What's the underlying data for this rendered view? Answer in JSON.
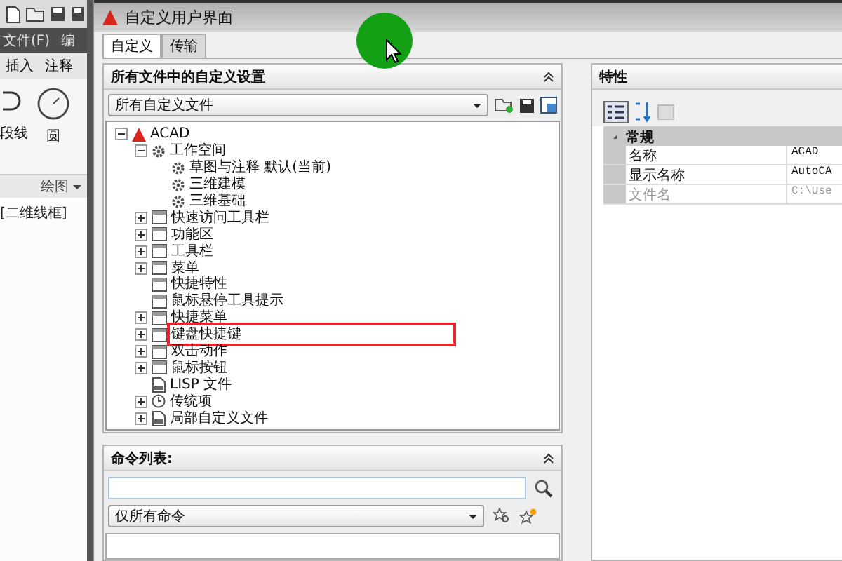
{
  "app": {
    "menu": [
      {
        "label": "文件(F)"
      },
      {
        "label": "编"
      }
    ],
    "ribbon_tabs": [
      {
        "label": "插入"
      },
      {
        "label": "注释"
      }
    ],
    "tools": [
      {
        "label": "段线",
        "kind": "arc"
      },
      {
        "label": "圆",
        "kind": "circle"
      }
    ],
    "panel_label": "绘图",
    "viewport_label": "[二维线框]"
  },
  "dialog": {
    "title": "自定义用户界面",
    "tabs": [
      {
        "label": "自定义",
        "selected": true
      },
      {
        "label": "传输",
        "selected": false
      }
    ]
  },
  "customizations": {
    "title": "所有文件中的自定义设置",
    "filter": "所有自定义文件",
    "tree": [
      {
        "label": "ACAD",
        "kind": "logo",
        "expanded": true,
        "children": [
          {
            "label": "工作空间",
            "kind": "gear",
            "expanded": true,
            "children": [
              {
                "label": "草图与注释 默认(当前)",
                "kind": "gear"
              },
              {
                "label": "三维建模",
                "kind": "gear"
              },
              {
                "label": "三维基础",
                "kind": "gear"
              }
            ]
          },
          {
            "label": "快速访问工具栏",
            "kind": "window",
            "expanded": false
          },
          {
            "label": "功能区",
            "kind": "window",
            "expanded": false
          },
          {
            "label": "工具栏",
            "kind": "window",
            "expanded": false
          },
          {
            "label": "菜单",
            "kind": "window",
            "expanded": false
          },
          {
            "label": "快捷特性",
            "kind": "window"
          },
          {
            "label": "鼠标悬停工具提示",
            "kind": "window"
          },
          {
            "label": "快捷菜单",
            "kind": "window",
            "expanded": false
          },
          {
            "label": "键盘快捷键",
            "kind": "window",
            "expanded": false,
            "highlighted": true
          },
          {
            "label": "双击动作",
            "kind": "window",
            "expanded": false
          },
          {
            "label": "鼠标按钮",
            "kind": "window",
            "expanded": false
          },
          {
            "label": "LISP 文件",
            "kind": "file"
          },
          {
            "label": "传统项",
            "kind": "clock",
            "expanded": false
          },
          {
            "label": "局部自定义文件",
            "kind": "file",
            "expanded": false
          }
        ]
      }
    ]
  },
  "command_list": {
    "title": "命令列表:",
    "filter": "仅所有命令"
  },
  "properties": {
    "title": "特性",
    "groups": [
      {
        "name": "常规",
        "expanded": true,
        "rows": [
          {
            "name": "名称",
            "value": "ACAD",
            "disabled": false
          },
          {
            "name": "显示名称",
            "value": "AutoCA",
            "disabled": false
          },
          {
            "name": "文件名",
            "value": "C:\\Use",
            "disabled": true
          }
        ]
      }
    ]
  }
}
